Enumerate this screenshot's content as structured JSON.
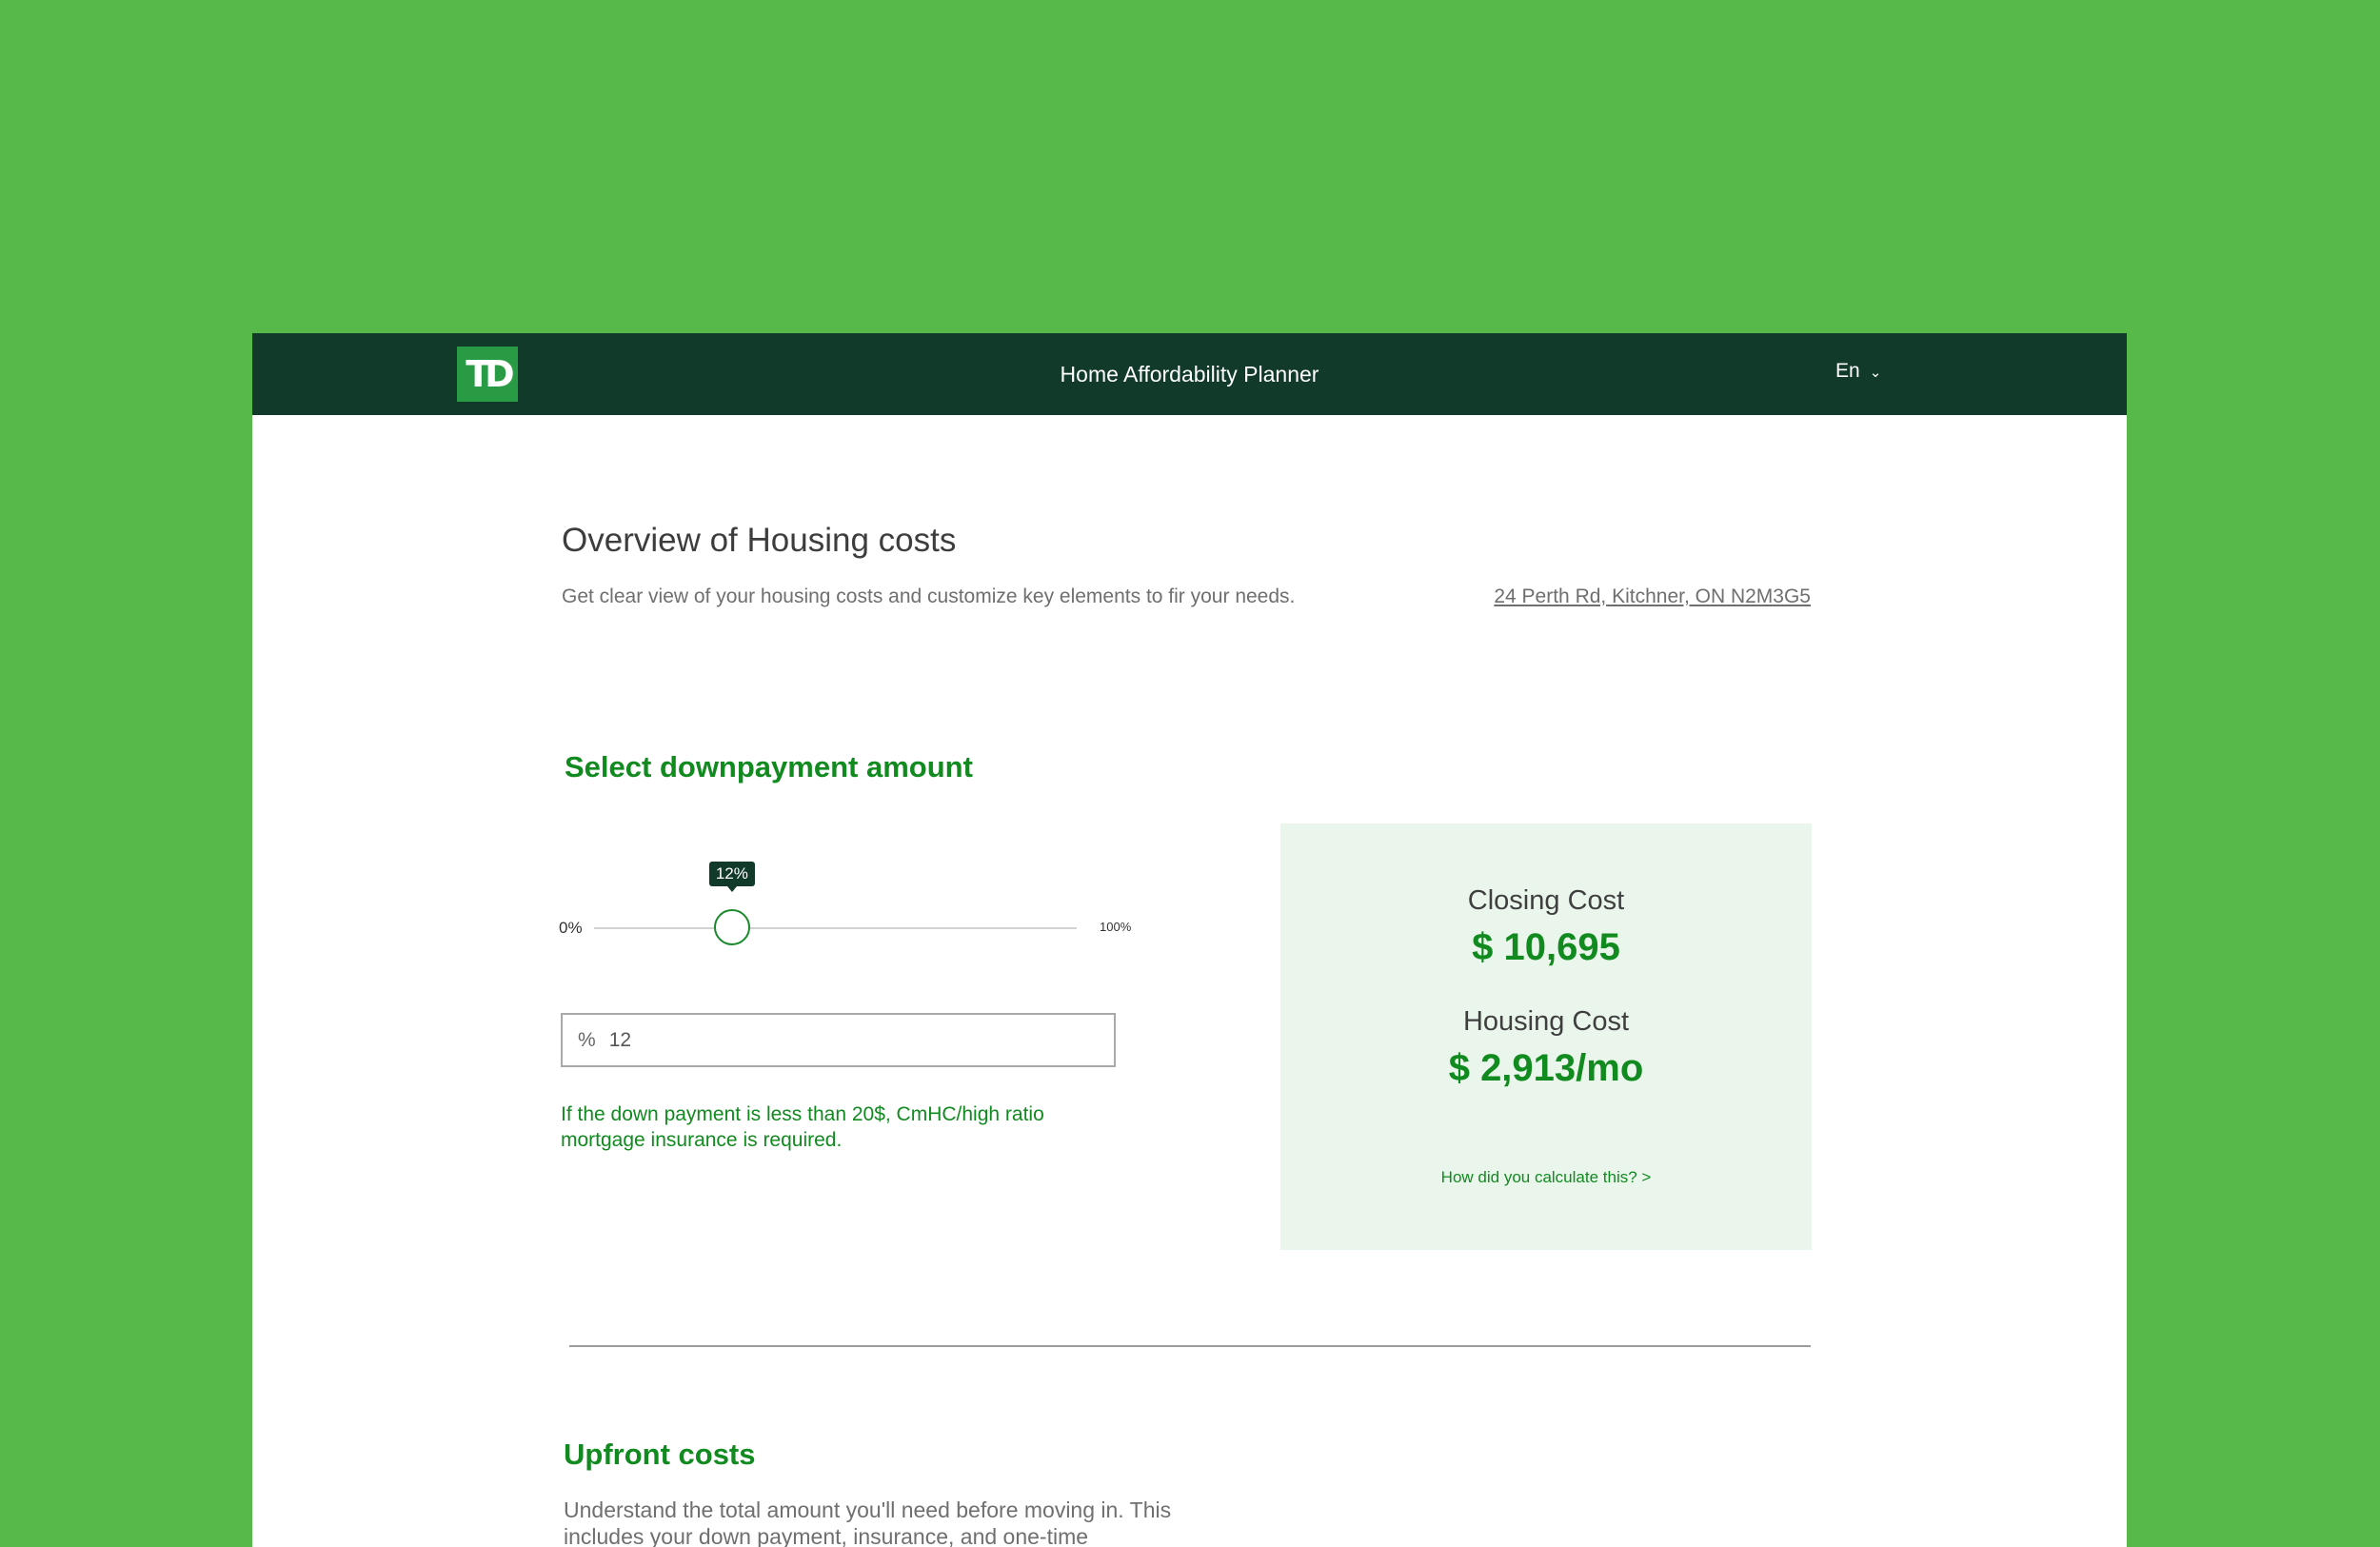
{
  "header": {
    "logo_text": "TD",
    "title": "Home Affordability Planner",
    "language": "En"
  },
  "overview": {
    "title": "Overview of Housing costs",
    "subtitle": "Get clear view of your housing costs and customize key elements to fir your needs.",
    "address": "24 Perth Rd, Kitchner, ON N2M3G5"
  },
  "downpayment": {
    "title": "Select downpayment amount",
    "slider": {
      "min_label": "0%",
      "max_label": "100%",
      "value_label": "12%",
      "value_percent": 12
    },
    "input": {
      "prefix": "%",
      "value": "12"
    },
    "note": "If the down payment is less than 20$, CmHC/high ratio mortgage insurance is required."
  },
  "costs": {
    "closing_label": "Closing Cost",
    "closing_amount": "$ 10,695",
    "housing_label": "Housing Cost",
    "housing_amount": "$ 2,913/mo",
    "calc_link": "How did you calculate this? >"
  },
  "upfront": {
    "title": "Upfront costs",
    "description": "Understand the total amount you'll need before moving in. This includes your down payment, insurance, and one-time"
  },
  "colors": {
    "background_green": "#57b94a",
    "header_dark_green": "#113a2b",
    "accent_green": "#118a1f",
    "card_bg": "#eaf6ec"
  },
  "icons": {
    "language_chevron": "chevron-down-icon"
  }
}
